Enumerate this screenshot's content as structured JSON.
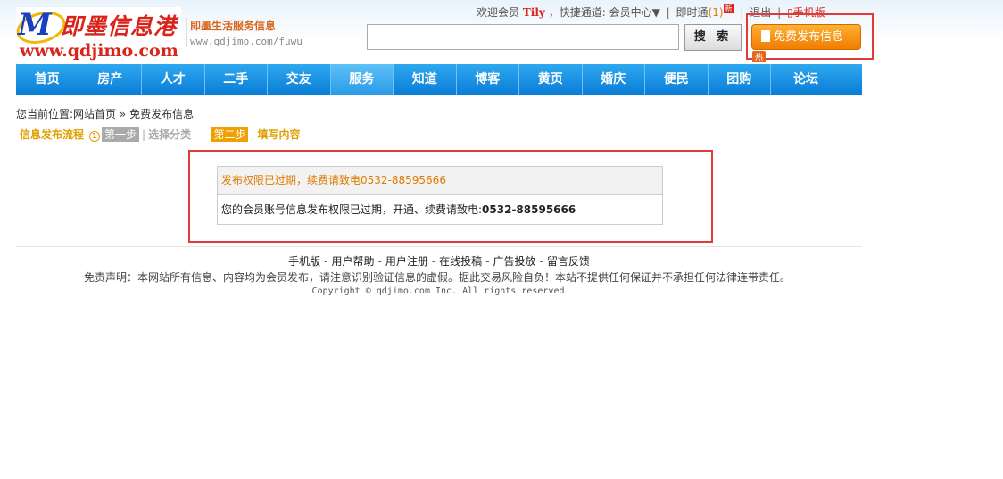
{
  "logo": {
    "brand_cn": "即墨信息港",
    "url_text": "www.qdjimo.com"
  },
  "tagline": {
    "title": "即墨生活服务信息",
    "url": "www.qdjimo.com/fuwu"
  },
  "topbar": {
    "welcome": "欢迎会员",
    "username": "Tily",
    "quick_access": "，快捷通道:",
    "member_center": "会员中心▼",
    "instant": "即时通",
    "instant_count": "(1)",
    "new_badge": "新",
    "logout": "退出",
    "mobile": "手机版"
  },
  "search": {
    "button_label": "搜 索",
    "value": ""
  },
  "publish": {
    "button_label": "免费发布信息",
    "hot_badge": "热"
  },
  "nav": [
    {
      "label": "首页"
    },
    {
      "label": "房产"
    },
    {
      "label": "人才"
    },
    {
      "label": "二手"
    },
    {
      "label": "交友"
    },
    {
      "label": "服务"
    },
    {
      "label": "知道"
    },
    {
      "label": "博客"
    },
    {
      "label": "黄页"
    },
    {
      "label": "婚庆"
    },
    {
      "label": "便民"
    },
    {
      "label": "团购"
    },
    {
      "label": "论坛"
    }
  ],
  "breadcrumb": {
    "prefix": "您当前位置:",
    "home": "网站首页",
    "arrow": "»",
    "current": "免费发布信息"
  },
  "steps": {
    "flow": "信息发布流程",
    "step1_num": "第一步",
    "step1_label": "选择分类",
    "step2_num": "第二步",
    "step2_label": "填写内容"
  },
  "message": {
    "title": "发布权限已过期，续费请致电0532-88595666",
    "body": "您的会员账号信息发布权限已过期，开通、续费请致电:",
    "phone": "0532-88595666"
  },
  "footer": {
    "links": [
      "手机版",
      "用户帮助",
      "用户注册",
      "在线投稿",
      "广告投放",
      "留言反馈"
    ],
    "disclaimer": "免责声明：本网站所有信息、内容均为会员发布，请注意识别验证信息的虚假。据此交易风险自负！本站不提供任何保证并不承担任何法律连带责任。",
    "copyright": "Copyright ©  qdjimo.com Inc. All rights reserved"
  }
}
